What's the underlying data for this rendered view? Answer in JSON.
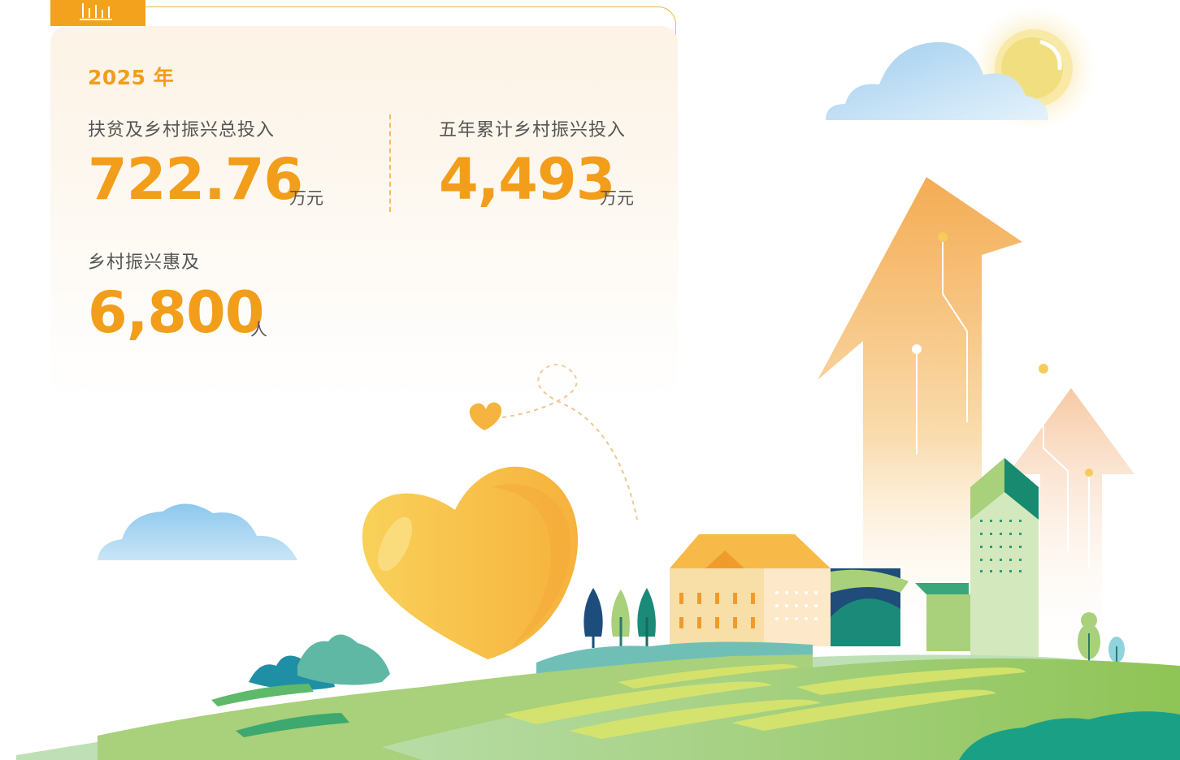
{
  "header": {
    "year": "2025 年"
  },
  "stats": [
    {
      "label": "扶贫及乡村振兴总投入",
      "value": "722.76",
      "unit": "万元"
    },
    {
      "label": "五年累计乡村振兴投入",
      "value": "4,493",
      "unit": "万元"
    },
    {
      "label": "乡村振兴惠及",
      "value": "6,800",
      "unit": "人"
    }
  ],
  "icons": {
    "badge": "bar-chart-icon",
    "illustration": "rural-revitalization-illustration"
  },
  "colors": {
    "accent": "#f29e1a",
    "label_text": "#555555",
    "card_bg": "#fdf3e6",
    "heart": "#f7bb39",
    "field_green": "#9ccb5c",
    "teal": "#1a8f7a"
  }
}
